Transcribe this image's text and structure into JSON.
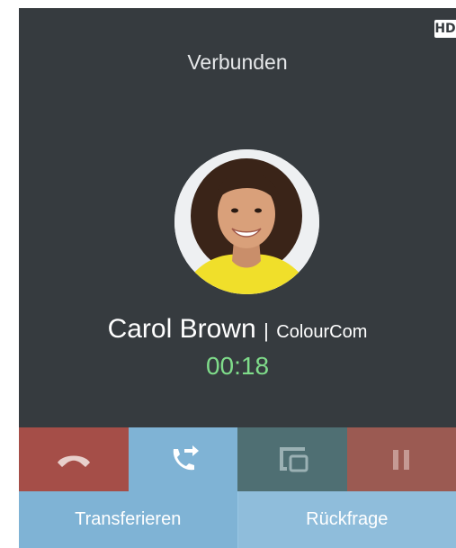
{
  "call": {
    "status": "Verbunden",
    "badge": "HD",
    "caller_name": "Carol Brown",
    "separator": "|",
    "company": "ColourCom",
    "duration": "00:18"
  },
  "actions": [
    {
      "icon": "hangup-icon"
    },
    {
      "icon": "transfer-call-icon"
    },
    {
      "icon": "device-switch-icon"
    },
    {
      "icon": "pause-icon"
    }
  ],
  "bottom_labels": {
    "transfer": "Transferieren",
    "consult": "Rückfrage"
  },
  "colors": {
    "background": "#363b3f",
    "hangup": "#a54e48",
    "transfer": "#7fb3d5",
    "device": "#4f6f73",
    "hold": "#9b5a52",
    "timer": "#7fdc8a"
  }
}
